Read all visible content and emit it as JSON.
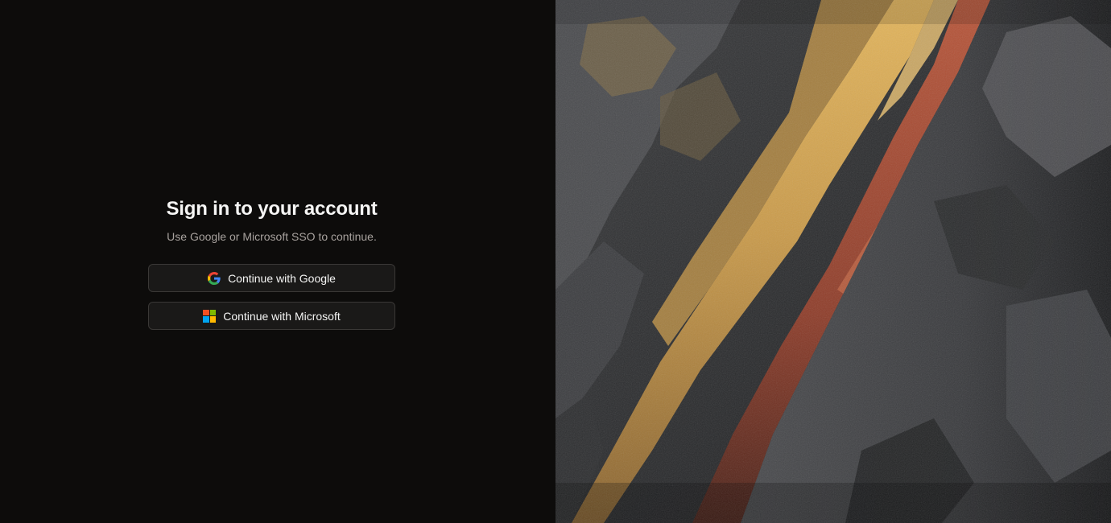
{
  "signin": {
    "title": "Sign in to your account",
    "subtitle": "Use Google or Microsoft SSO to continue."
  },
  "buttons": {
    "google": {
      "label": "Continue with Google",
      "icon": "google-icon"
    },
    "microsoft": {
      "label": "Continue with Microsoft",
      "icon": "microsoft-icon"
    }
  },
  "colors": {
    "background": "#0d0c0b",
    "button_bg": "#1a1918",
    "button_border": "#3a3836",
    "title": "#f5f5f4",
    "subtitle": "#a8a29e",
    "google_blue": "#4285F4",
    "google_red": "#EA4335",
    "google_yellow": "#FBBC05",
    "google_green": "#34A853",
    "ms_red": "#F25022",
    "ms_green": "#7FBA00",
    "ms_blue": "#00A4EF",
    "ms_yellow": "#FFB900"
  },
  "hero_image": {
    "subject": "rock-cliff-image"
  }
}
